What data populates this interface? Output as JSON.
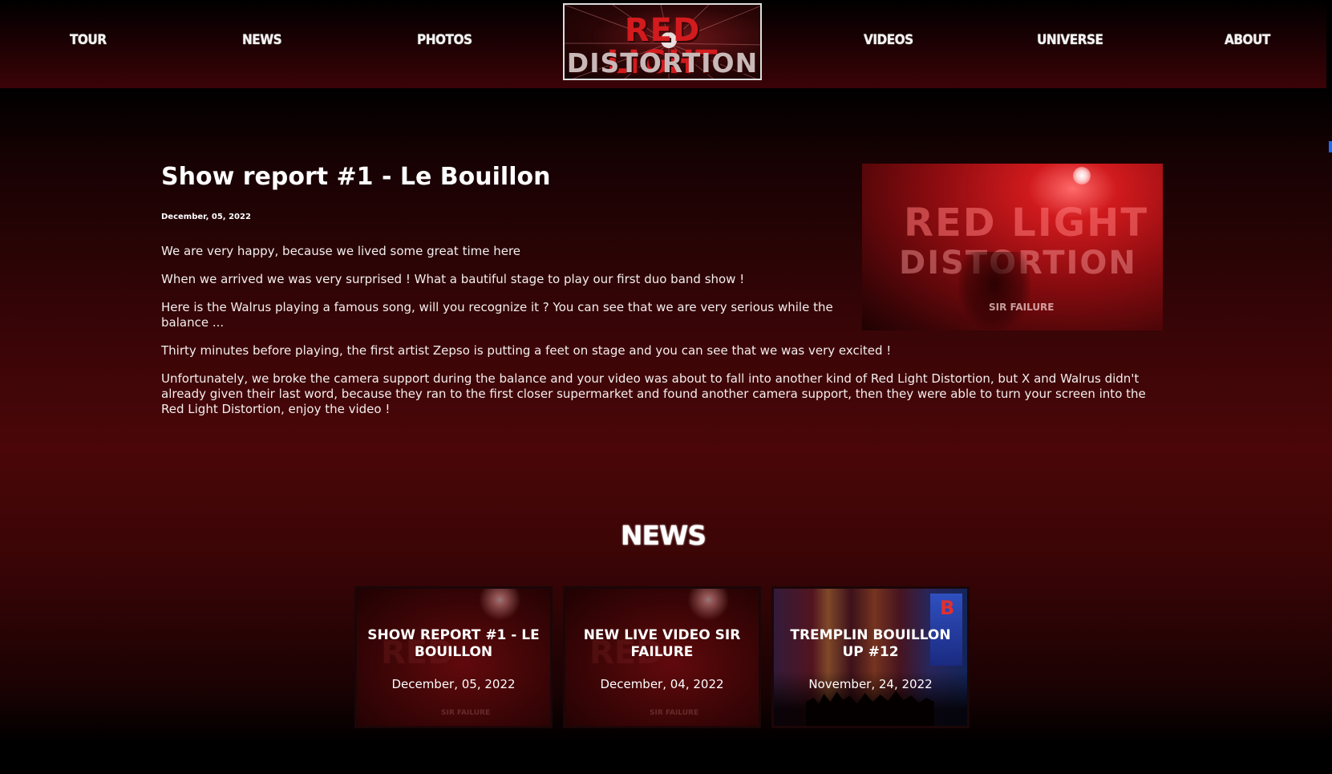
{
  "nav": {
    "tour": "TOUR",
    "news": "NEWS",
    "photos": "PHOTOS",
    "videos": "VIDEOS",
    "universe": "UNIVERSE",
    "about": "ABOUT"
  },
  "logo": {
    "line1": "RED LIGHT",
    "line2": "DISTORTION"
  },
  "article": {
    "title": "Show report #1 - Le Bouillon",
    "date": "December, 05, 2022",
    "paragraphs": [
      "We are very happy, because we lived some great time here",
      "When we arrived we was very surprised ! What a bautiful stage to play our first duo band show !",
      "Here is the Walrus playing a famous song, will you recognize it ? You can see that we are very serious while the balance ...",
      "Thirty minutes before playing, the first artist Zepso is putting a feet on stage and you can see that we was very excited !",
      "Unfortunately, we broke the camera support during the balance and your video was about to fall into another kind of Red Light Distortion, but X and Walrus didn't already given their last word, because they ran to the first closer supermarket and found another camera support, then they were able to turn your screen into the Red Light Distortion, enjoy the video !"
    ],
    "image_text": {
      "line1": "RED LIGHT",
      "line2": "DISTORTION",
      "caption": "SIR FAILURE"
    }
  },
  "news": {
    "heading": "NEWS",
    "cards": [
      {
        "title": "SHOW REPORT #1 - LE BOUILLON",
        "date": "December, 05, 2022",
        "image_caption": "SIR FAILURE"
      },
      {
        "title": "NEW LIVE VIDEO SIR FAILURE",
        "date": "December, 04, 2022",
        "image_caption": "SIR FAILURE"
      },
      {
        "title": "TREMPLIN BOUILLON UP #12",
        "date": "November, 24, 2022",
        "image_caption": "B"
      }
    ]
  },
  "colors": {
    "background": "#000000",
    "header_gradient_bottom": "#3b0307",
    "body_glow": "#4a0608",
    "accent_red": "#d31b1e",
    "text": "#ffffff",
    "scroll_indicator": "#1a6dff"
  }
}
